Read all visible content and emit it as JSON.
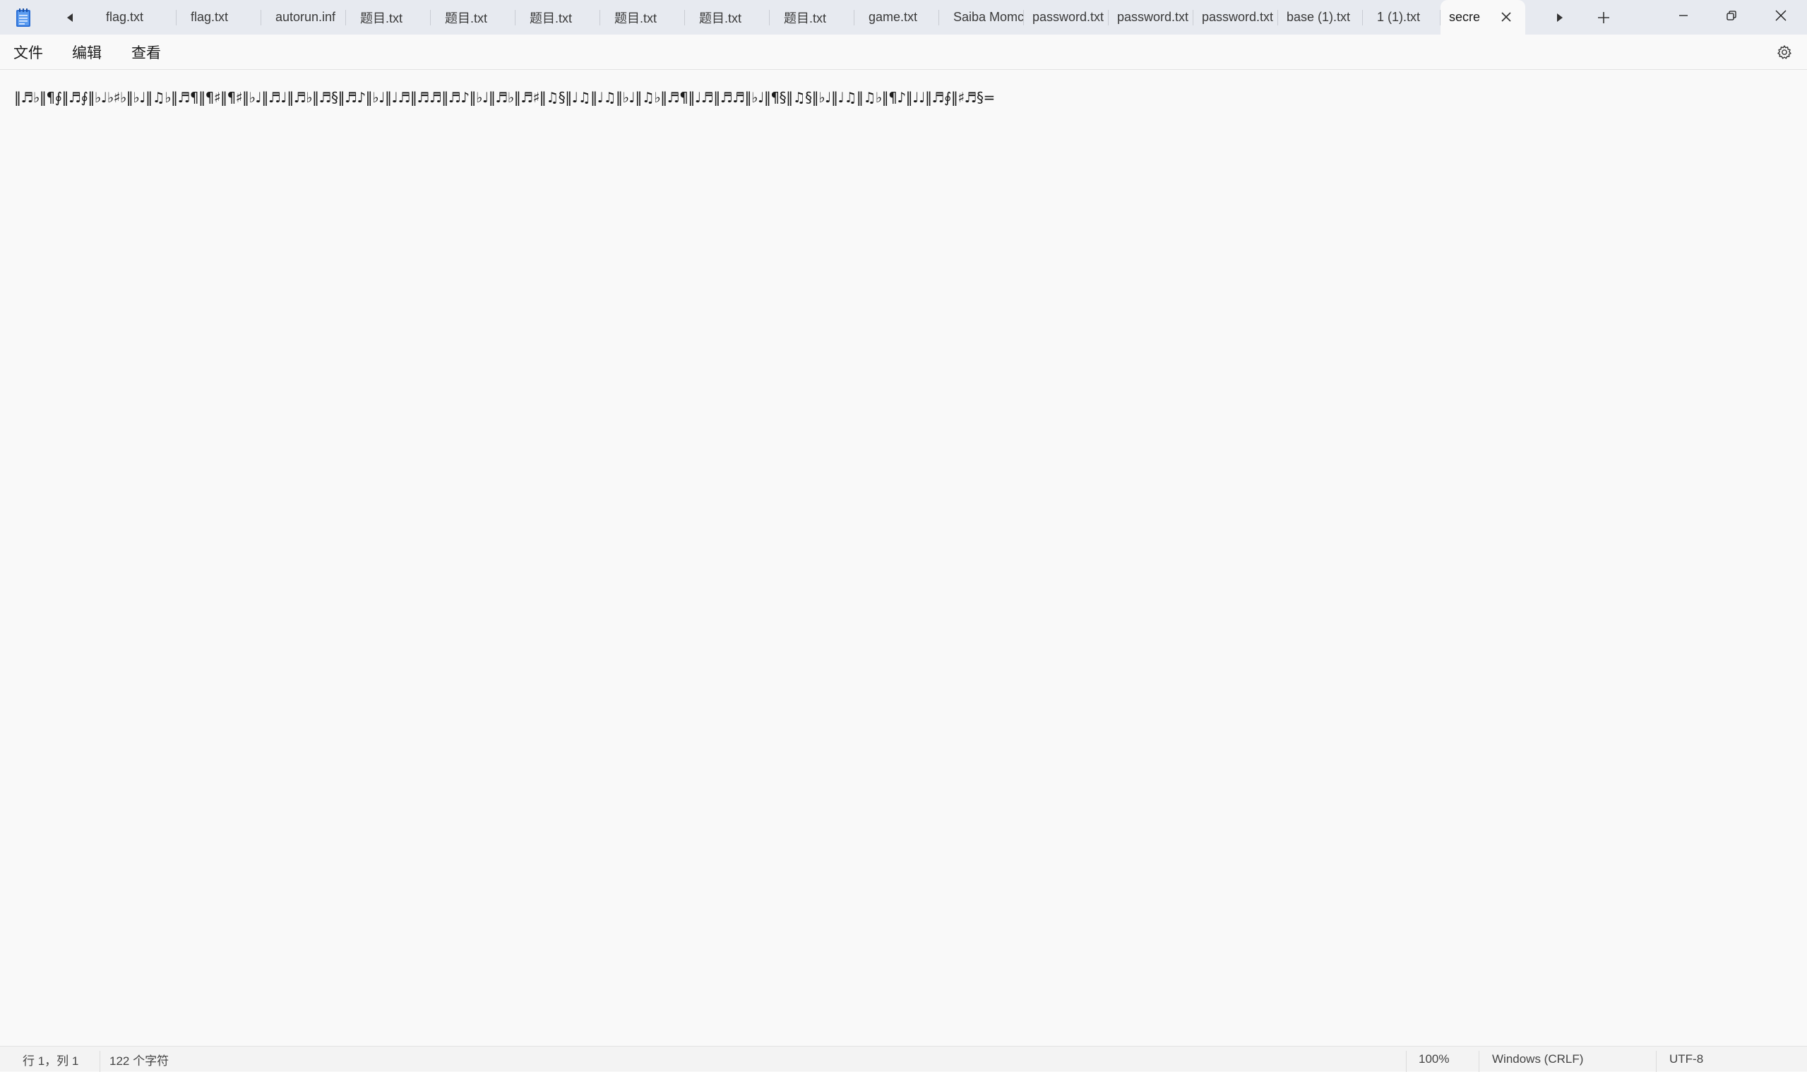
{
  "tabs": [
    {
      "label": "flag.txt"
    },
    {
      "label": "flag.txt"
    },
    {
      "label": "autorun.inf"
    },
    {
      "label": "题目.txt"
    },
    {
      "label": "题目.txt"
    },
    {
      "label": "题目.txt"
    },
    {
      "label": "题目.txt"
    },
    {
      "label": "题目.txt"
    },
    {
      "label": "题目.txt"
    },
    {
      "label": "game.txt"
    },
    {
      "label": "Saiba Momc"
    },
    {
      "label": "password.txt"
    },
    {
      "label": "password.txt"
    },
    {
      "label": "password.txt"
    },
    {
      "label": "base (1).txt"
    },
    {
      "label": "1 (1).txt"
    }
  ],
  "active_tab": {
    "label": "secre"
  },
  "menu": {
    "file": "文件",
    "edit": "编辑",
    "view": "查看"
  },
  "editor": {
    "content": "‖♬♭‖¶∮‖♬∮‖♭♩♭♯♭‖♭♩‖♫♭‖♬¶‖¶♯‖¶♯‖♭♩‖♬♩‖♬♭‖♬§‖♬♪‖♭♩‖♩♬‖♬♬‖♬♪‖♭♩‖♬♭‖♬♯‖♫§‖♩♫‖♩♫‖♭♩‖♫♭‖♬¶‖♩♬‖♬♬‖♭♩‖¶§‖♫§‖♭♩‖♩♫‖♫♭‖¶♪‖♩♩‖♬∮‖♯♬§="
  },
  "status": {
    "position": "行 1，列 1",
    "char_count": "122 个字符",
    "zoom": "100%",
    "line_ending": "Windows (CRLF)",
    "encoding": "UTF-8"
  },
  "icons": {
    "app": "notepad-icon",
    "scroll_left": "caret-left-icon",
    "scroll_right": "caret-right-icon",
    "new_tab": "plus-icon",
    "close_tab": "close-icon",
    "minimize": "minimize-icon",
    "maximize": "restore-icon",
    "close_window": "close-icon",
    "settings": "gear-icon"
  },
  "colors": {
    "titlebar_bg": "#e7eaf0",
    "editor_bg": "#f9f9f9",
    "app_icon_accent": "#2b6fd6"
  }
}
